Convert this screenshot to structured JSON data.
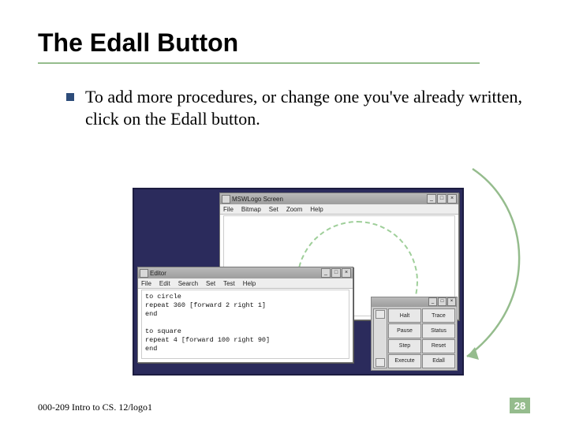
{
  "slide": {
    "title": "The Edall Button",
    "body": "To add more procedures, or change one you've already written, click on the Edall button."
  },
  "screenshot": {
    "main_window": {
      "title": "MSWLogo Screen",
      "menus": [
        "File",
        "Bitmap",
        "Set",
        "Zoom",
        "Help"
      ]
    },
    "editor_window": {
      "title": "Editor",
      "menus": [
        "File",
        "Edit",
        "Search",
        "Set",
        "Test",
        "Help"
      ],
      "code_lines": [
        "to circle",
        "repeat 360 [forward 2 right 1]",
        "end",
        "",
        "to square",
        "repeat 4 [forward 100 right 90]",
        "end"
      ]
    },
    "commander": {
      "buttons": [
        "Halt",
        "Trace",
        "Pause",
        "Status",
        "Step",
        "Reset",
        "Execute",
        "Edall"
      ]
    }
  },
  "footer": {
    "left": "000-209 Intro to CS. 12/logo1",
    "page": "28"
  }
}
